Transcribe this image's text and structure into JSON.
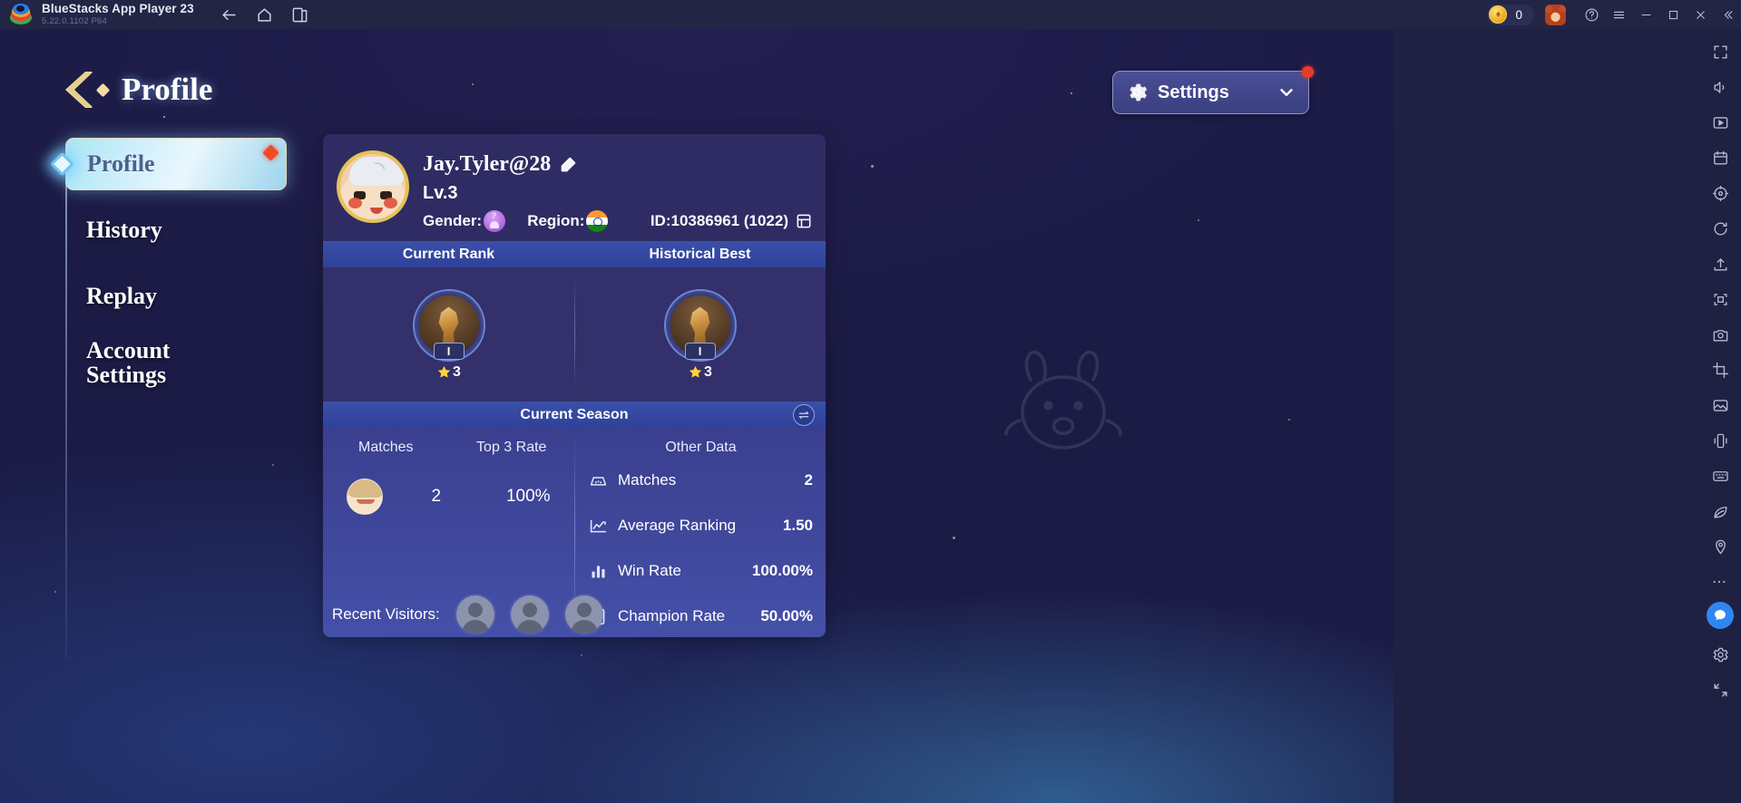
{
  "titlebar": {
    "app_name": "BlueStacks App Player 23",
    "version": "5.22.0.1102  P64",
    "logo_icon": "bluestacks-logo-icon",
    "nav": [
      {
        "name": "back",
        "icon": "arrow-left-icon"
      },
      {
        "name": "home",
        "icon": "home-icon"
      },
      {
        "name": "multi-instance",
        "icon": "windows-stack-icon"
      }
    ],
    "coin_icon": "coin-icon",
    "coin_value": "0",
    "account_avatar_icon": "bear-avatar-icon",
    "help_icon": "question-circle-icon",
    "menu_icon": "hamburger-menu-icon",
    "minimize_icon": "minimize-icon",
    "maximize_icon": "maximize-icon",
    "close_icon": "close-icon",
    "collapse_icon": "double-chevron-left-icon"
  },
  "header": {
    "back_icon": "back-chevron-icon",
    "title": "Profile",
    "settings": {
      "label": "Settings",
      "gear_icon": "gear-icon",
      "chevron_icon": "chevron-down-icon",
      "has_notification": true
    }
  },
  "sidebar": {
    "items": [
      {
        "label": "Profile",
        "active": true,
        "notification": true,
        "marker_icon": "diamond-marker-icon"
      },
      {
        "label": "History",
        "active": false,
        "notification": false
      },
      {
        "label": "Replay",
        "active": false,
        "notification": false
      },
      {
        "label": "Account Settings",
        "label_line1": "Account",
        "label_line2": "Settings",
        "active": false,
        "notification": false
      }
    ]
  },
  "profile_card": {
    "avatar_icon": "player-avatar-icon",
    "username": "Jay.Tyler@28",
    "edit_icon": "edit-pencil-icon",
    "level": "Lv.3",
    "gender_label": "Gender:",
    "gender_icon": "gender-unknown-icon",
    "region_label": "Region:",
    "region_icon": "india-flag-icon",
    "id_text": "ID:10386961 (1022)",
    "copy_icon": "copy-icon",
    "rank_headers": [
      "Current Rank",
      "Historical Best"
    ],
    "ranks": [
      {
        "name": "Current Rank",
        "medal_icon": "bronze-medal-icon",
        "tier": "I",
        "star_icon": "star-icon",
        "stars": "3"
      },
      {
        "name": "Historical Best",
        "medal_icon": "bronze-medal-icon",
        "tier": "I",
        "star_icon": "star-icon",
        "stars": "3"
      }
    ],
    "season": {
      "band_title": "Current Season",
      "toggle_icon": "swap-arrows-icon",
      "left": {
        "headers": [
          "Matches",
          "Top 3 Rate"
        ],
        "hero_icon": "hero-portrait-icon",
        "matches": "2",
        "top3_rate": "100%"
      },
      "right": {
        "header": "Other Data",
        "stats": [
          {
            "icon": "matches-icon",
            "label": "Matches",
            "value": "2"
          },
          {
            "icon": "trend-up-icon",
            "label": "Average Ranking",
            "value": "1.50"
          },
          {
            "icon": "bar-chart-icon",
            "label": "Win Rate",
            "value": "100.00%"
          },
          {
            "icon": "champion-badge-icon",
            "label": "Champion Rate",
            "value": "50.00%"
          }
        ]
      }
    }
  },
  "visitors": {
    "label": "Recent Visitors:",
    "avatars": [
      "visitor-avatar-1",
      "visitor-avatar-2",
      "visitor-avatar-3"
    ]
  },
  "right_toolbar": {
    "items": [
      {
        "icon": "fullscreen-icon"
      },
      {
        "icon": "volume-icon"
      },
      {
        "icon": "media-play-icon"
      },
      {
        "icon": "calendar-icon"
      },
      {
        "icon": "location-icon"
      },
      {
        "icon": "rotate-icon"
      },
      {
        "icon": "upload-apk-icon"
      },
      {
        "icon": "screenshot-icon"
      },
      {
        "icon": "camera-icon"
      },
      {
        "icon": "crop-icon"
      },
      {
        "icon": "gallery-icon"
      },
      {
        "icon": "shake-icon"
      },
      {
        "icon": "keymap-icon"
      },
      {
        "icon": "eco-mode-icon"
      },
      {
        "icon": "pin-icon"
      },
      {
        "icon": "more-dots-icon"
      },
      {
        "icon": "chat-icon",
        "accent": true
      },
      {
        "icon": "settings-gear-icon"
      },
      {
        "icon": "expand-icon"
      }
    ]
  },
  "colors": {
    "accent_blue": "#2f86f0",
    "notification_red": "#e83c2a",
    "gold": "#e6c257",
    "band_blue": "#3a50a8",
    "card_top": "#2e2c63"
  }
}
